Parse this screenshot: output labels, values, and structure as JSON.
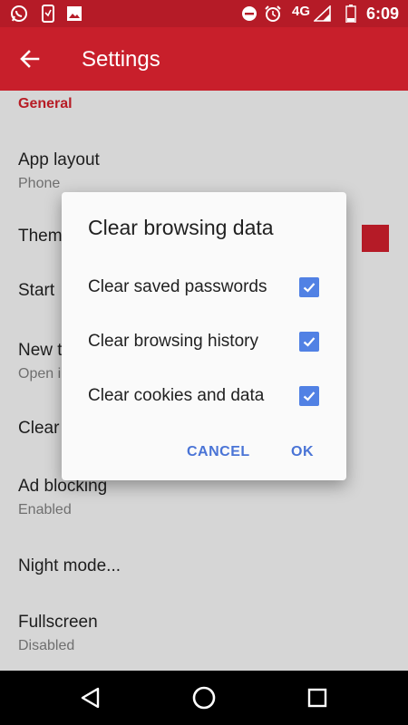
{
  "status_bar": {
    "time": "6:09",
    "network": "4G",
    "icons": [
      "whatsapp-icon",
      "screenshot-phone-icon",
      "image-icon",
      "do-not-disturb-icon",
      "alarm-icon",
      "signal-icon",
      "battery-icon"
    ]
  },
  "app_bar": {
    "title": "Settings",
    "back_icon": "arrow-left-icon",
    "color": "#c81f2b"
  },
  "settings": {
    "section": "General",
    "items": [
      {
        "title": "App layout",
        "summary": "Phone"
      },
      {
        "title": "Them",
        "summary": ""
      },
      {
        "title": "Start",
        "summary": ""
      },
      {
        "title": "New t",
        "summary": "Open i"
      },
      {
        "title": "Clear",
        "summary": ""
      },
      {
        "title": "Ad blocking",
        "summary": "Enabled"
      },
      {
        "title": "Night mode...",
        "summary": ""
      },
      {
        "title": "Fullscreen",
        "summary": "Disabled"
      }
    ],
    "theme_swatch_color": "#b51b27"
  },
  "dialog": {
    "title": "Clear browsing data",
    "options": [
      {
        "label": "Clear saved passwords",
        "checked": true
      },
      {
        "label": "Clear browsing history",
        "checked": true
      },
      {
        "label": "Clear cookies and data",
        "checked": true
      }
    ],
    "cancel_label": "CANCEL",
    "ok_label": "OK",
    "accent_color": "#4a74d6"
  },
  "nav_bar": {
    "icons": [
      "back-triangle-icon",
      "home-circle-icon",
      "recents-square-icon"
    ]
  }
}
